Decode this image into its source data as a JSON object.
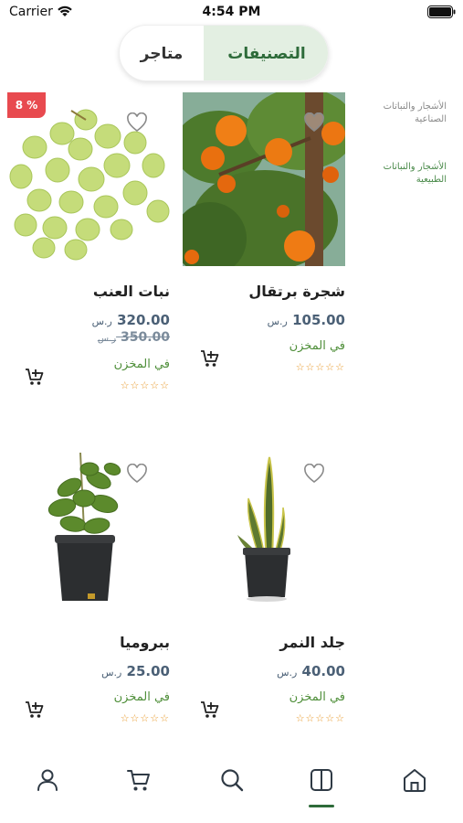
{
  "status_bar": {
    "carrier": "Carrier",
    "time": "4:54 PM"
  },
  "segment": {
    "stores_label": "متاجر",
    "categories_label": "التصنيفات",
    "active": "categories"
  },
  "sidebar": {
    "items": [
      {
        "label": "الأشجار والنباتات الصناعية"
      },
      {
        "label": "الأشجار والنباتات الطبيعية"
      }
    ]
  },
  "products": [
    {
      "name": "شجرة برتقال",
      "price": "105.00",
      "currency": "ر.س",
      "stock": "في المخزن",
      "rating_stars": "☆☆☆☆☆",
      "image": "orange-tree"
    },
    {
      "name": "نبات العنب",
      "price": "320.00",
      "old_price": "350.00",
      "currency": "ر.س",
      "discount": "8 %",
      "stock": "في المخزن",
      "rating_stars": "☆☆☆☆☆",
      "image": "grapes"
    },
    {
      "name": "جلد النمر",
      "price": "40.00",
      "currency": "ر.س",
      "stock": "في المخزن",
      "rating_stars": "☆☆☆☆☆",
      "image": "snake-plant"
    },
    {
      "name": "ببروميا",
      "price": "25.00",
      "currency": "ر.س",
      "stock": "في المخزن",
      "rating_stars": "☆☆☆☆☆",
      "image": "peperomia"
    }
  ],
  "bottom_nav": {
    "items": [
      "profile-icon",
      "cart-icon",
      "search-icon",
      "categories-icon",
      "home-icon"
    ],
    "active": "categories-icon"
  },
  "colors": {
    "accent": "#2e6b3a",
    "discount": "#e84a4f",
    "stock": "#4f8f3a",
    "price": "#4b6076",
    "star": "#e89a2c"
  }
}
